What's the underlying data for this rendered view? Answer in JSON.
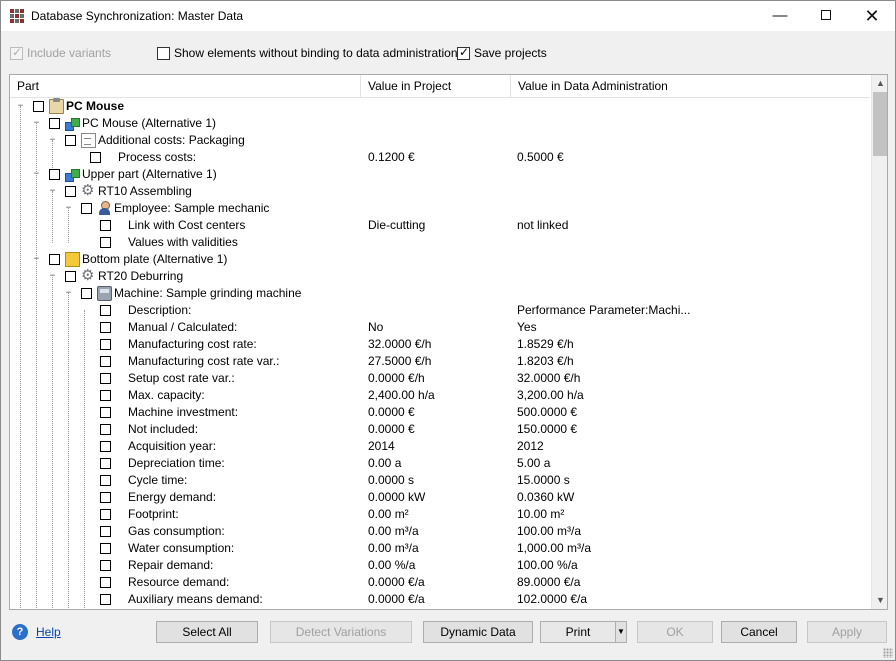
{
  "window": {
    "title": "Database Synchronization: Master Data",
    "minimize_glyph": "—",
    "close_glyph": "✕"
  },
  "options": {
    "include_variants": {
      "label": "Include variants",
      "checked": true,
      "enabled": false
    },
    "show_unbound": {
      "label": "Show elements without binding to data administration",
      "checked": false
    },
    "save_projects": {
      "label": "Save projects",
      "checked": true
    }
  },
  "columns": {
    "part": "Part",
    "project": "Value in Project",
    "admin": "Value in Data Administration"
  },
  "tree": [
    {
      "label": "PC Mouse",
      "level": 0,
      "icon": "clipboard-icon",
      "bold": true,
      "project": "",
      "admin": ""
    },
    {
      "label": "PC Mouse (Alternative 1)",
      "level": 1,
      "icon": "cubes-icon",
      "project": "",
      "admin": ""
    },
    {
      "label": "Additional costs: Packaging",
      "level": 2,
      "icon": "document-icon",
      "project": "",
      "admin": ""
    },
    {
      "label": "Process costs:",
      "level": 3,
      "icon": "",
      "project": "0.1200 €",
      "admin": "0.5000 €"
    },
    {
      "label": "Upper part (Alternative 1)",
      "level": 1,
      "icon": "cubes-icon",
      "project": "",
      "admin": ""
    },
    {
      "label": "RT10 Assembling",
      "level": 2,
      "icon": "gear-icon",
      "project": "",
      "admin": ""
    },
    {
      "label": "Employee: Sample mechanic",
      "level": 3,
      "icon": "person-icon",
      "project": "",
      "admin": ""
    },
    {
      "label": "Link with Cost centers",
      "level": 4,
      "icon": "",
      "project": "Die-cutting",
      "admin": "not linked"
    },
    {
      "label": "Values with validities",
      "level": 4,
      "icon": "",
      "project": "",
      "admin": ""
    },
    {
      "label": "Bottom plate (Alternative 1)",
      "level": 1,
      "icon": "cube-icon",
      "project": "",
      "admin": ""
    },
    {
      "label": "RT20 Deburring",
      "level": 2,
      "icon": "gear-icon",
      "project": "",
      "admin": ""
    },
    {
      "label": "Machine: Sample grinding machine",
      "level": 3,
      "icon": "machine-icon",
      "project": "",
      "admin": ""
    },
    {
      "label": "Description:",
      "level": 4,
      "icon": "",
      "project": "",
      "admin": "Performance Parameter:Machi..."
    },
    {
      "label": "Manual / Calculated:",
      "level": 4,
      "icon": "",
      "project": "No",
      "admin": "Yes"
    },
    {
      "label": "Manufacturing cost rate:",
      "level": 4,
      "icon": "",
      "project": "32.0000 €/h",
      "admin": "1.8529 €/h"
    },
    {
      "label": "Manufacturing cost rate var.:",
      "level": 4,
      "icon": "",
      "project": "27.5000 €/h",
      "admin": "1.8203 €/h"
    },
    {
      "label": "Setup cost rate var.:",
      "level": 4,
      "icon": "",
      "project": "0.0000 €/h",
      "admin": "32.0000 €/h"
    },
    {
      "label": "Max. capacity:",
      "level": 4,
      "icon": "",
      "project": "2,400.00 h/a",
      "admin": "3,200.00 h/a"
    },
    {
      "label": "Machine investment:",
      "level": 4,
      "icon": "",
      "project": "0.0000 €",
      "admin": "500.0000 €"
    },
    {
      "label": "Not included:",
      "level": 4,
      "icon": "",
      "project": "0.0000 €",
      "admin": "150.0000 €"
    },
    {
      "label": "Acquisition year:",
      "level": 4,
      "icon": "",
      "project": "2014",
      "admin": "2012"
    },
    {
      "label": "Depreciation time:",
      "level": 4,
      "icon": "",
      "project": "0.00 a",
      "admin": "5.00 a"
    },
    {
      "label": "Cycle time:",
      "level": 4,
      "icon": "",
      "project": "0.0000 s",
      "admin": "15.0000 s"
    },
    {
      "label": "Energy demand:",
      "level": 4,
      "icon": "",
      "project": "0.0000 kW",
      "admin": "0.0360 kW"
    },
    {
      "label": "Footprint:",
      "level": 4,
      "icon": "",
      "project": "0.00 m²",
      "admin": "10.00 m²"
    },
    {
      "label": "Gas consumption:",
      "level": 4,
      "icon": "",
      "project": "0.00 m³/a",
      "admin": "100.00 m³/a"
    },
    {
      "label": "Water consumption:",
      "level": 4,
      "icon": "",
      "project": "0.00 m³/a",
      "admin": "1,000.00 m³/a"
    },
    {
      "label": "Repair demand:",
      "level": 4,
      "icon": "",
      "project": "0.00 %/a",
      "admin": "100.00 %/a"
    },
    {
      "label": "Resource demand:",
      "level": 4,
      "icon": "",
      "project": "0.0000 €/a",
      "admin": "89.0000 €/a"
    },
    {
      "label": "Auxiliary means demand:",
      "level": 4,
      "icon": "",
      "project": "0.0000 €/a",
      "admin": "102.0000 €/a"
    }
  ],
  "footer": {
    "help": "Help",
    "select_all": "Select All",
    "detect_variations": "Detect Variations",
    "dynamic_data": "Dynamic Data",
    "print": "Print",
    "ok": "OK",
    "cancel": "Cancel",
    "apply": "Apply"
  }
}
